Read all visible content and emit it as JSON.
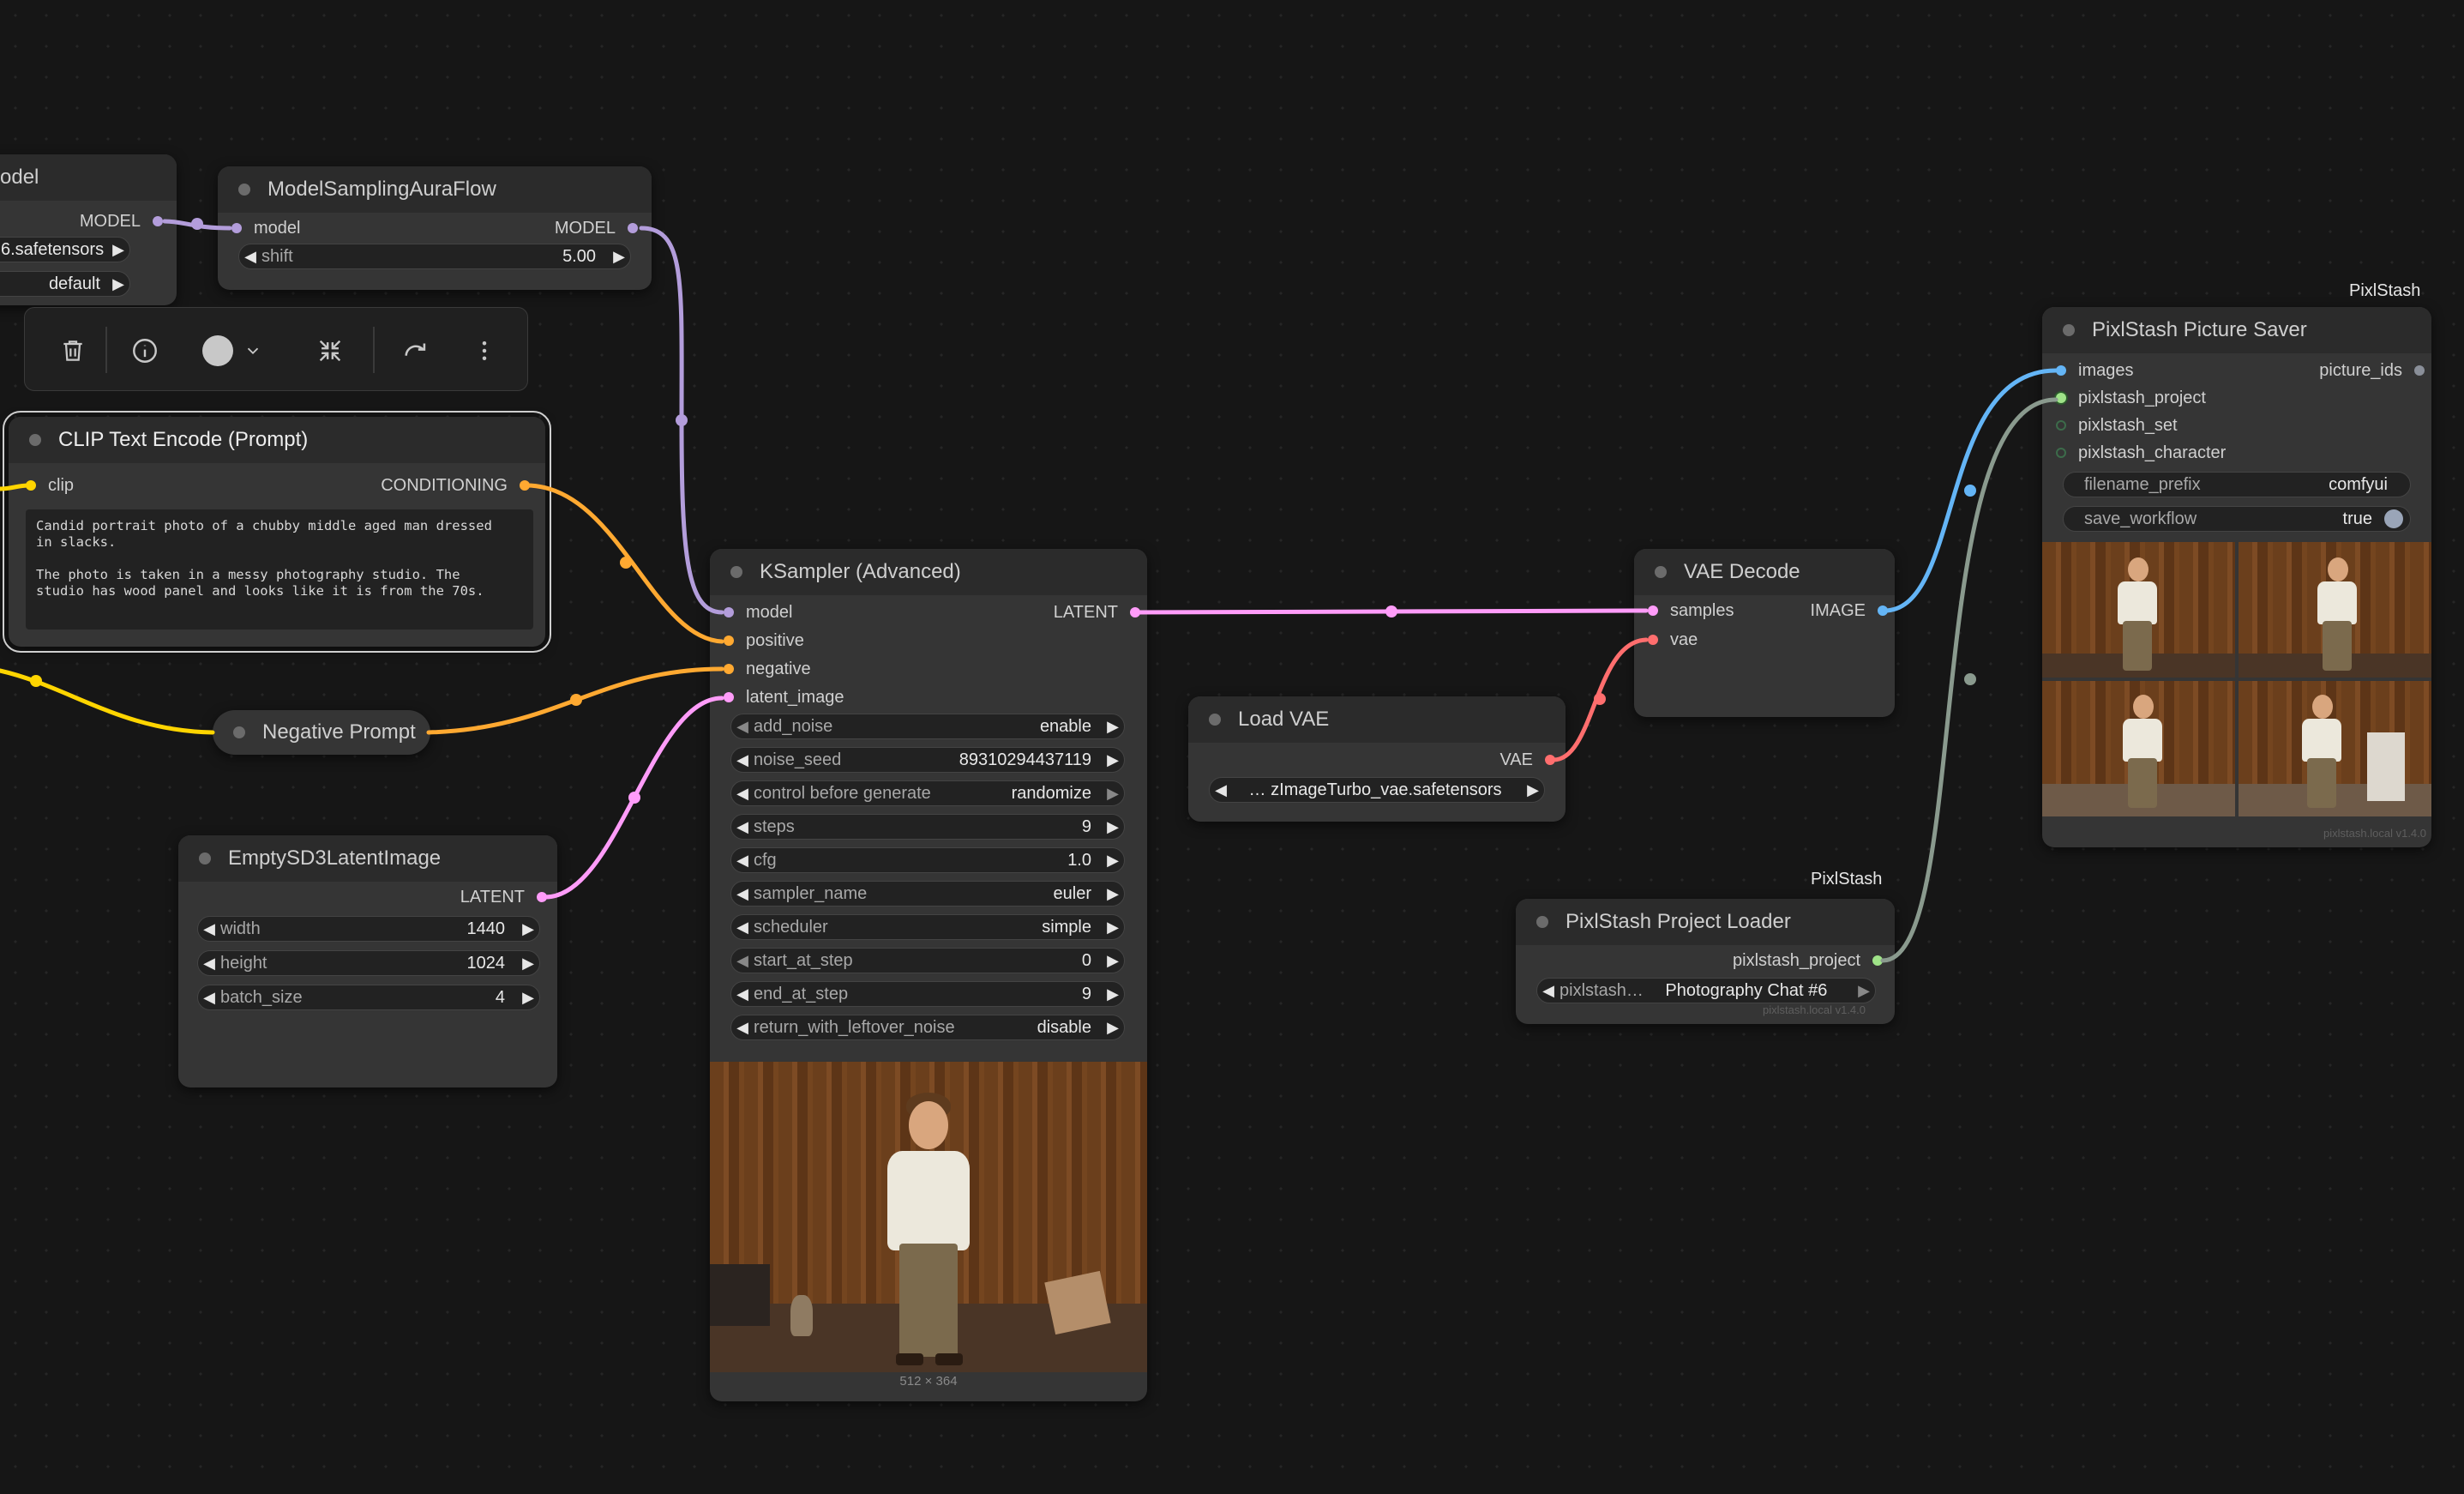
{
  "colors": {
    "model": "#b39ddb",
    "clip": "#ffd500",
    "conditioning": "#ffa931",
    "latent": "#ff9cf9",
    "vae": "#ff6e6e",
    "image": "#64b5f6",
    "project": "#9fe388",
    "gray": "#8a9a8e"
  },
  "toolbar": {
    "delete": "trash-icon",
    "info": "info-icon",
    "color": "color-circle-icon",
    "collapse": "compress-icon",
    "bypass": "redo-icon",
    "more": "more-vertical-icon"
  },
  "model_loader": {
    "title": "odel",
    "out_model": "MODEL",
    "widget1": "6.safetensors",
    "widget2": "default"
  },
  "model_sampling": {
    "title": "ModelSamplingAuraFlow",
    "in_model": "model",
    "out_model": "MODEL",
    "shift_label": "shift",
    "shift_value": "5.00"
  },
  "clip_encode": {
    "title": "CLIP Text Encode (Prompt)",
    "in_clip": "clip",
    "out_conditioning": "CONDITIONING",
    "text": "Candid portrait photo of a chubby middle aged man dressed\nin slacks.\n\nThe photo is taken in a messy photography studio. The\nstudio has wood panel and looks like it is from the 70s."
  },
  "negative_prompt": {
    "title": "Negative Prompt"
  },
  "empty_latent": {
    "title": "EmptySD3LatentImage",
    "out_latent": "LATENT",
    "widgets": [
      {
        "label": "width",
        "value": "1440"
      },
      {
        "label": "height",
        "value": "1024"
      },
      {
        "label": "batch_size",
        "value": "4"
      }
    ]
  },
  "ksampler": {
    "title": "KSampler (Advanced)",
    "inputs": [
      "model",
      "positive",
      "negative",
      "latent_image"
    ],
    "out_latent": "LATENT",
    "widgets": [
      {
        "label": "add_noise",
        "value": "enable"
      },
      {
        "label": "noise_seed",
        "value": "89310294437119"
      },
      {
        "label": "control before generate",
        "value": "randomize"
      },
      {
        "label": "steps",
        "value": "9"
      },
      {
        "label": "cfg",
        "value": "1.0"
      },
      {
        "label": "sampler_name",
        "value": "euler"
      },
      {
        "label": "scheduler",
        "value": "simple"
      },
      {
        "label": "start_at_step",
        "value": "0"
      },
      {
        "label": "end_at_step",
        "value": "9"
      },
      {
        "label": "return_with_leftover_noise",
        "value": "disable"
      }
    ],
    "preview_size": "512 × 364"
  },
  "load_vae": {
    "title": "Load VAE",
    "out_vae": "VAE",
    "vae_name": "… zImageTurbo_vae.safetensors"
  },
  "vae_decode": {
    "title": "VAE Decode",
    "in_samples": "samples",
    "in_vae": "vae",
    "out_image": "IMAGE"
  },
  "project_loader": {
    "badge": "PixlStash",
    "title": "PixlStash Project Loader",
    "out_project": "pixlstash_project",
    "widget_label": "pixlstash…",
    "widget_value": "Photography Chat #6",
    "footer": "pixlstash.local  v1.4.0"
  },
  "picture_saver": {
    "badge": "PixlStash",
    "title": "PixlStash Picture Saver",
    "inputs": [
      "images",
      "pixlstash_project",
      "pixlstash_set",
      "pixlstash_character"
    ],
    "out_picture_ids": "picture_ids",
    "filename_prefix_label": "filename_prefix",
    "filename_prefix_value": "comfyui",
    "save_workflow_label": "save_workflow",
    "save_workflow_value": "true",
    "footer": "pixlstash.local  v1.4.0"
  }
}
